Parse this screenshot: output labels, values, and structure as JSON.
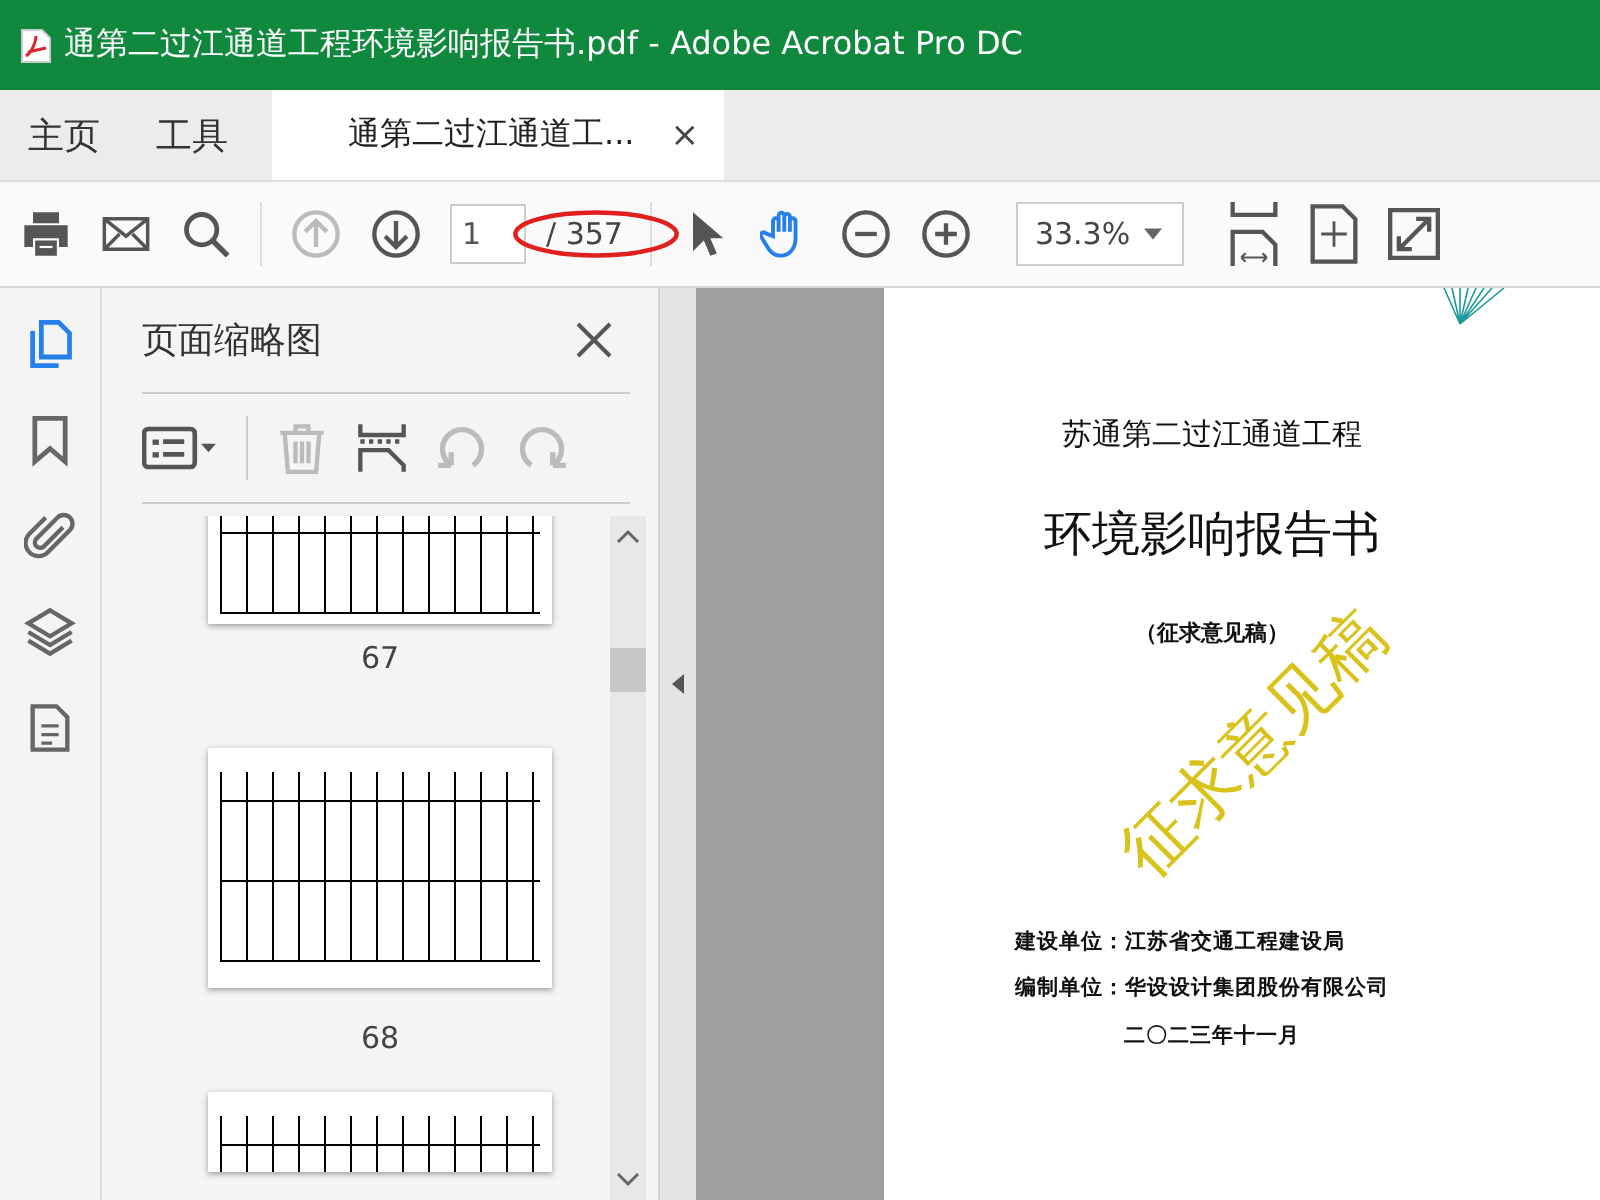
{
  "window": {
    "title": "通第二过江通道工程环境影响报告书.pdf - Adobe Acrobat Pro DC"
  },
  "tabs": [
    {
      "label": "主页",
      "selected": false
    },
    {
      "label": "工具",
      "selected": false
    },
    {
      "label": "通第二过江通道工...",
      "selected": true,
      "close": "×"
    }
  ],
  "toolbar": {
    "page_number": "1",
    "page_total": "/ 357",
    "zoom": "33.3%",
    "previous_disabled": true,
    "tools": [
      {
        "kind": "select",
        "selected": false
      },
      {
        "kind": "hand",
        "selected": true
      }
    ]
  },
  "rail": [
    {
      "kind": "pages",
      "selected": true
    },
    {
      "kind": "bookmarks",
      "selected": false
    },
    {
      "kind": "attachments",
      "selected": false
    },
    {
      "kind": "layers",
      "selected": false
    },
    {
      "kind": "document",
      "selected": false
    }
  ],
  "sidebar": {
    "title": "页面缩略图",
    "thumbnails": [
      {
        "label": "67",
        "selected": false
      },
      {
        "label": "68",
        "selected": false
      }
    ]
  },
  "document": {
    "subtitle": "苏通第二过江通道工程",
    "title": "环境影响报告书",
    "note": "（征求意见稿）",
    "watermark": "征求意见稿",
    "lines": [
      "建设单位：江苏省交通工程建设局",
      "编制单位：华设设计集团股份有限公司"
    ],
    "date": "二〇二三年十一月"
  }
}
